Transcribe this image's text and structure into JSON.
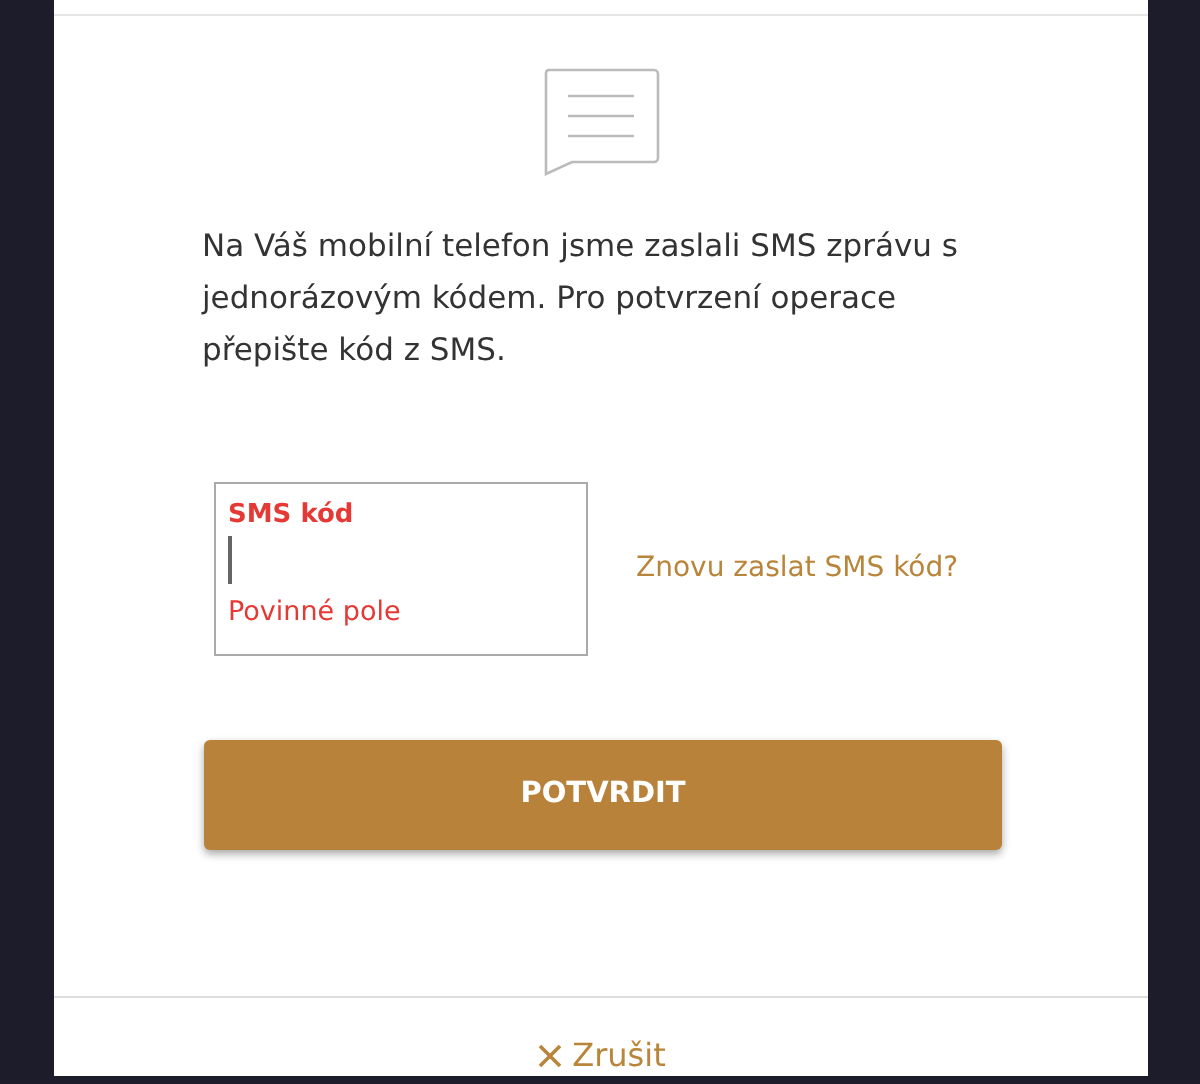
{
  "message": "Na Váš mobilní telefon jsme zaslali SMS zprávu s jednorázovým kódem. Pro potvrzení operace přepište kód z SMS.",
  "sms_field": {
    "label": "SMS kód",
    "invalid": true,
    "error": "Povinné pole"
  },
  "resend_link": "Znovu zaslat SMS kód?",
  "confirm_button": "POTVRDIT",
  "cancel_button": "Zrušit"
}
